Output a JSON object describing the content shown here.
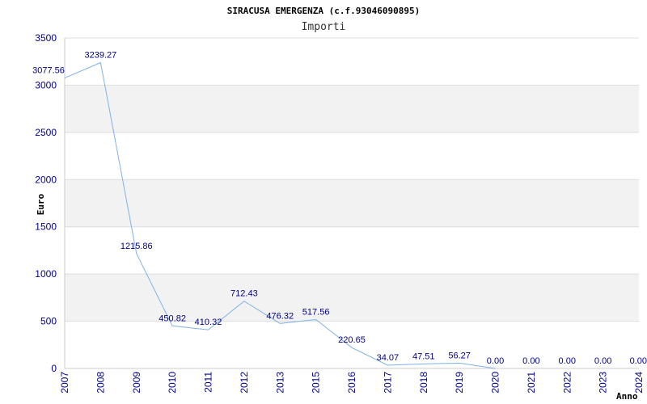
{
  "chart_data": {
    "type": "line",
    "title": "SIRACUSA EMERGENZA (c.f.93046090895)",
    "subtitle": "Importi",
    "xlabel": "Anno",
    "ylabel": "Euro",
    "x": [
      "2007",
      "2008",
      "2009",
      "2010",
      "2011",
      "2012",
      "2013",
      "2015",
      "2016",
      "2017",
      "2018",
      "2019",
      "2020",
      "2021",
      "2022",
      "2023",
      "2024"
    ],
    "values": [
      3077.56,
      3239.27,
      1215.86,
      450.82,
      410.32,
      712.43,
      476.32,
      517.56,
      220.65,
      34.07,
      47.51,
      56.27,
      0.0,
      null,
      null,
      null,
      null
    ],
    "data_labels": [
      "3077.56",
      "3239.27",
      "1215.86",
      "450.82",
      "410.32",
      "712.43",
      "476.32",
      "517.56",
      "220.65",
      "34.07",
      "47.51",
      "56.27",
      "0.00",
      "0.00",
      "0.00",
      "0.00",
      "0.00"
    ],
    "ylim": [
      0,
      3500
    ],
    "yticks": [
      0,
      500,
      1000,
      1500,
      2000,
      2500,
      3000,
      3500
    ],
    "grid": "horizontal bands",
    "colors": {
      "line": "#7fb2e5",
      "band": "#f2f2f2",
      "grid": "#dddddd",
      "tick": "#00008b",
      "label": "#000080"
    }
  }
}
